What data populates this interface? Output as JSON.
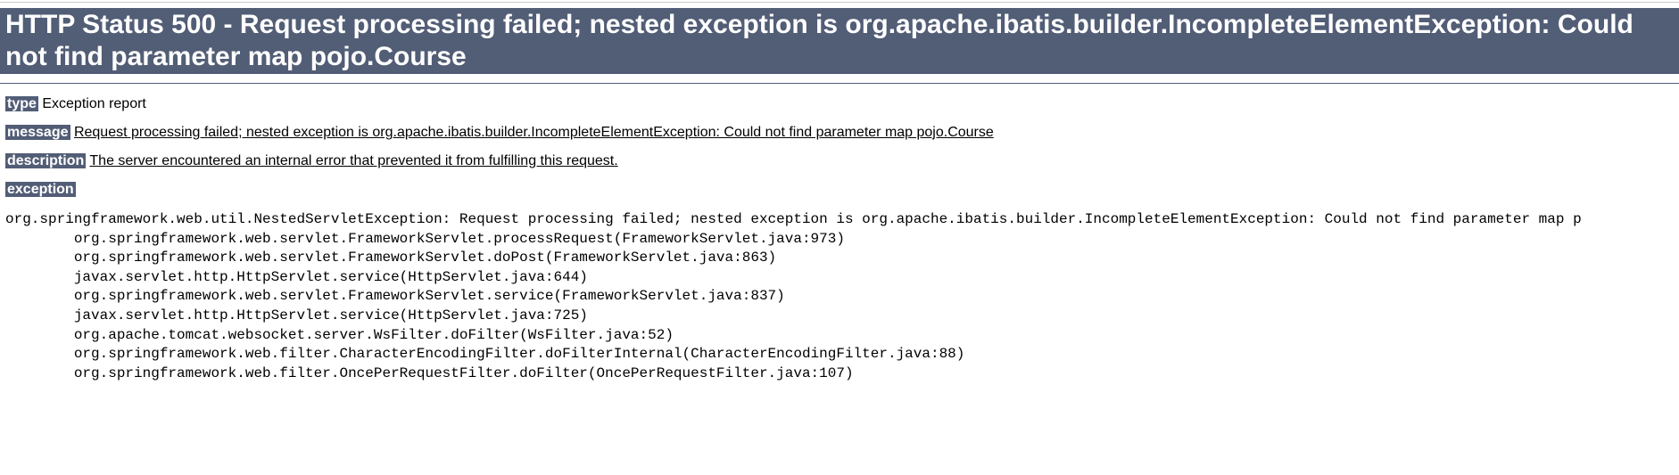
{
  "header": {
    "title": "HTTP Status 500 - Request processing failed; nested exception is org.apache.ibatis.builder.IncompleteElementException: Could not find parameter map pojo.Course"
  },
  "labels": {
    "type": "type",
    "message": "message",
    "description": "description",
    "exception": "exception"
  },
  "values": {
    "type": "Exception report",
    "message": "Request processing failed; nested exception is org.apache.ibatis.builder.IncompleteElementException: Could not find parameter map pojo.Course",
    "description": "The server encountered an internal error that prevented it from fulfilling this request."
  },
  "exception": {
    "stack_trace": "org.springframework.web.util.NestedServletException: Request processing failed; nested exception is org.apache.ibatis.builder.IncompleteElementException: Could not find parameter map p\n\torg.springframework.web.servlet.FrameworkServlet.processRequest(FrameworkServlet.java:973)\n\torg.springframework.web.servlet.FrameworkServlet.doPost(FrameworkServlet.java:863)\n\tjavax.servlet.http.HttpServlet.service(HttpServlet.java:644)\n\torg.springframework.web.servlet.FrameworkServlet.service(FrameworkServlet.java:837)\n\tjavax.servlet.http.HttpServlet.service(HttpServlet.java:725)\n\torg.apache.tomcat.websocket.server.WsFilter.doFilter(WsFilter.java:52)\n\torg.springframework.web.filter.CharacterEncodingFilter.doFilterInternal(CharacterEncodingFilter.java:88)\n\torg.springframework.web.filter.OncePerRequestFilter.doFilter(OncePerRequestFilter.java:107)"
  }
}
